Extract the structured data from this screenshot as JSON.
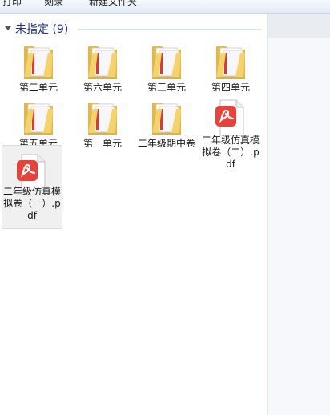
{
  "toolbar": {
    "buttons": [
      "打印",
      "刻录",
      "新建文件夹"
    ]
  },
  "group": {
    "title": "未指定 (9)"
  },
  "items": [
    {
      "label": "第二单元",
      "type": "folder"
    },
    {
      "label": "第六单元",
      "type": "folder"
    },
    {
      "label": "第三单元",
      "type": "folder"
    },
    {
      "label": "第四单元",
      "type": "folder"
    },
    {
      "label": "第五单元",
      "type": "folder"
    },
    {
      "label": "第一单元",
      "type": "folder"
    },
    {
      "label": "二年级期中卷",
      "type": "folder"
    },
    {
      "label": "二年级仿真模拟卷（二）.pdf",
      "type": "pdf"
    },
    {
      "label": "二年级仿真模拟卷（一）.pdf",
      "type": "pdf",
      "selected": true
    }
  ],
  "colors": {
    "accent": "#1e3287",
    "folder": "#f3d36b",
    "pdf_badge": "#e5433b"
  },
  "icons": {
    "folder": "folder-icon",
    "pdf": "pdf-file-icon",
    "expand": "chevron-down-icon"
  }
}
